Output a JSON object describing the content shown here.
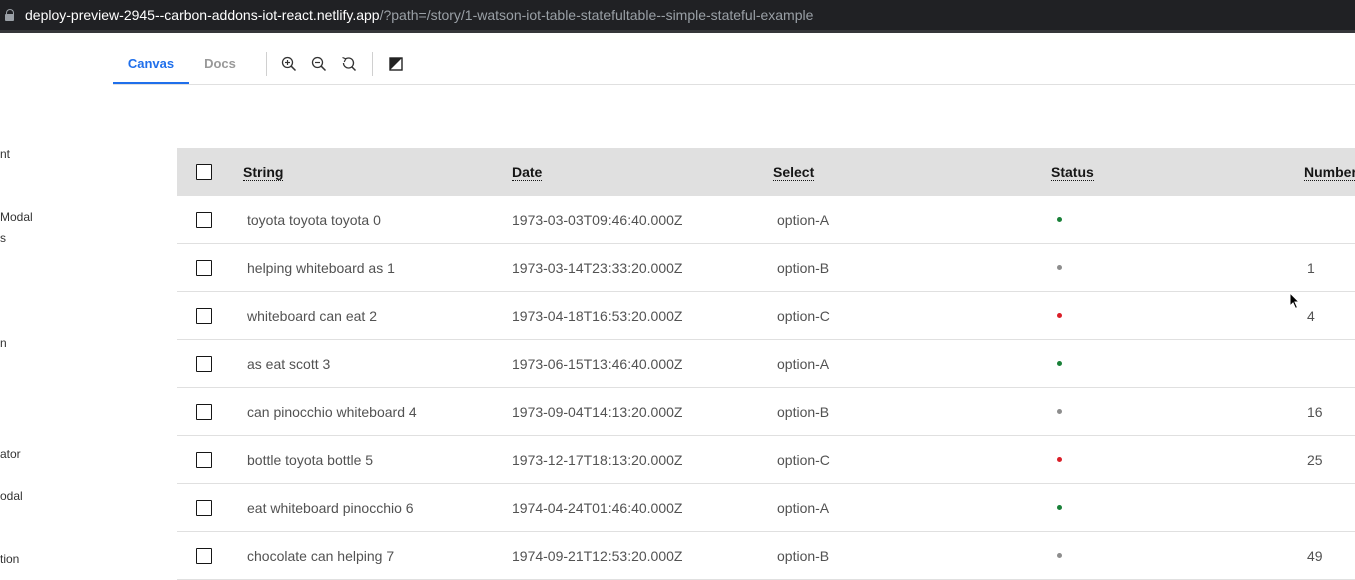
{
  "browser": {
    "url_host": "deploy-preview-2945--carbon-addons-iot-react.netlify.app",
    "url_path": "/?path=/story/1-watson-iot-table-statefultable--simple-stateful-example"
  },
  "sidebar": {
    "items": [
      {
        "label": "nt",
        "top": 0
      },
      {
        "label": "Modal",
        "top": 0
      },
      {
        "label": "s",
        "top": 0
      },
      {
        "label": "n",
        "top": 0
      },
      {
        "label": "ator",
        "top": 0
      },
      {
        "label": "odal",
        "top": 0
      },
      {
        "label": "tion",
        "top": 0
      }
    ]
  },
  "toolbar": {
    "tab_canvas": "Canvas",
    "tab_docs": "Docs",
    "icons": [
      "zoom-in-icon",
      "zoom-out-icon",
      "zoom-reset-icon",
      "contrast-icon"
    ]
  },
  "table": {
    "columns": [
      "String",
      "Date",
      "Select",
      "Status",
      "Number"
    ],
    "status_colors": {
      "green": "#198038",
      "gray": "#8d8d8d",
      "red": "#da1e28"
    },
    "rows": [
      {
        "string": "toyota toyota toyota 0",
        "date": "1973-03-03T09:46:40.000Z",
        "select": "option-A",
        "status": "green",
        "number": ""
      },
      {
        "string": "helping whiteboard as 1",
        "date": "1973-03-14T23:33:20.000Z",
        "select": "option-B",
        "status": "gray",
        "number": "1"
      },
      {
        "string": "whiteboard can eat 2",
        "date": "1973-04-18T16:53:20.000Z",
        "select": "option-C",
        "status": "red",
        "number": "4"
      },
      {
        "string": "as eat scott 3",
        "date": "1973-06-15T13:46:40.000Z",
        "select": "option-A",
        "status": "green",
        "number": ""
      },
      {
        "string": "can pinocchio whiteboard 4",
        "date": "1973-09-04T14:13:20.000Z",
        "select": "option-B",
        "status": "gray",
        "number": "16"
      },
      {
        "string": "bottle toyota bottle 5",
        "date": "1973-12-17T18:13:20.000Z",
        "select": "option-C",
        "status": "red",
        "number": "25"
      },
      {
        "string": "eat whiteboard pinocchio 6",
        "date": "1974-04-24T01:46:40.000Z",
        "select": "option-A",
        "status": "green",
        "number": ""
      },
      {
        "string": "chocolate can helping 7",
        "date": "1974-09-21T12:53:20.000Z",
        "select": "option-B",
        "status": "gray",
        "number": "49"
      }
    ]
  }
}
